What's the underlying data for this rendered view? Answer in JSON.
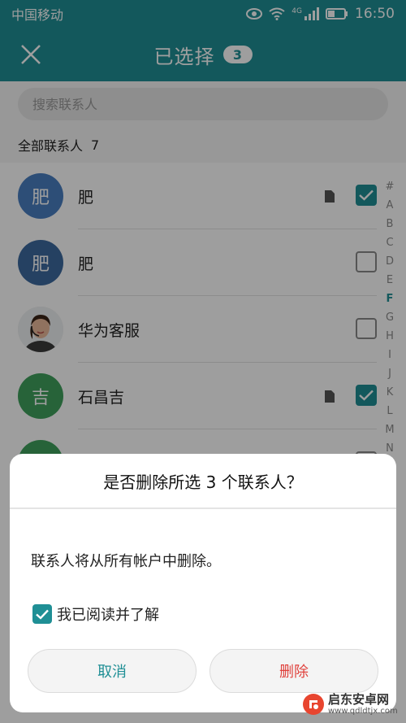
{
  "status_bar": {
    "carrier": "中国移动",
    "network": "4G",
    "time": "16:50"
  },
  "app_bar": {
    "title": "已选择",
    "selected_count": "3"
  },
  "search": {
    "placeholder": "搜索联系人"
  },
  "section": {
    "label": "全部联系人",
    "count": "7"
  },
  "contacts": [
    {
      "name": "肥",
      "avatar_text": "肥",
      "avatar_color": "#4a7fc1",
      "checked": true,
      "sim": true
    },
    {
      "name": "肥",
      "avatar_text": "肥",
      "avatar_color": "#3d6a9e",
      "checked": false,
      "sim": false
    },
    {
      "name": "华为客服",
      "avatar_text": "",
      "avatar_color": "#f0e6dc",
      "checked": false,
      "sim": false
    },
    {
      "name": "石昌吉",
      "avatar_text": "吉",
      "avatar_color": "#3fa05c",
      "checked": true,
      "sim": true
    },
    {
      "name": "",
      "avatar_text": "",
      "avatar_color": "#3fa05c",
      "checked": false,
      "sim": false
    }
  ],
  "alphabet_index": [
    "#",
    "A",
    "B",
    "C",
    "D",
    "E",
    "F",
    "G",
    "H",
    "I",
    "J",
    "K",
    "L",
    "M",
    "N"
  ],
  "alphabet_active": "F",
  "dialog": {
    "title": "是否删除所选 3 个联系人？",
    "message": "联系人将从所有帐户中删除。",
    "confirm_label": "我已阅读并了解",
    "cancel_label": "取消",
    "delete_label": "删除"
  },
  "watermark": {
    "text": "启东安卓网",
    "url": "www.qdldtjx.com"
  },
  "colors": {
    "accent": "#1f8f95",
    "danger": "#e0413c"
  }
}
